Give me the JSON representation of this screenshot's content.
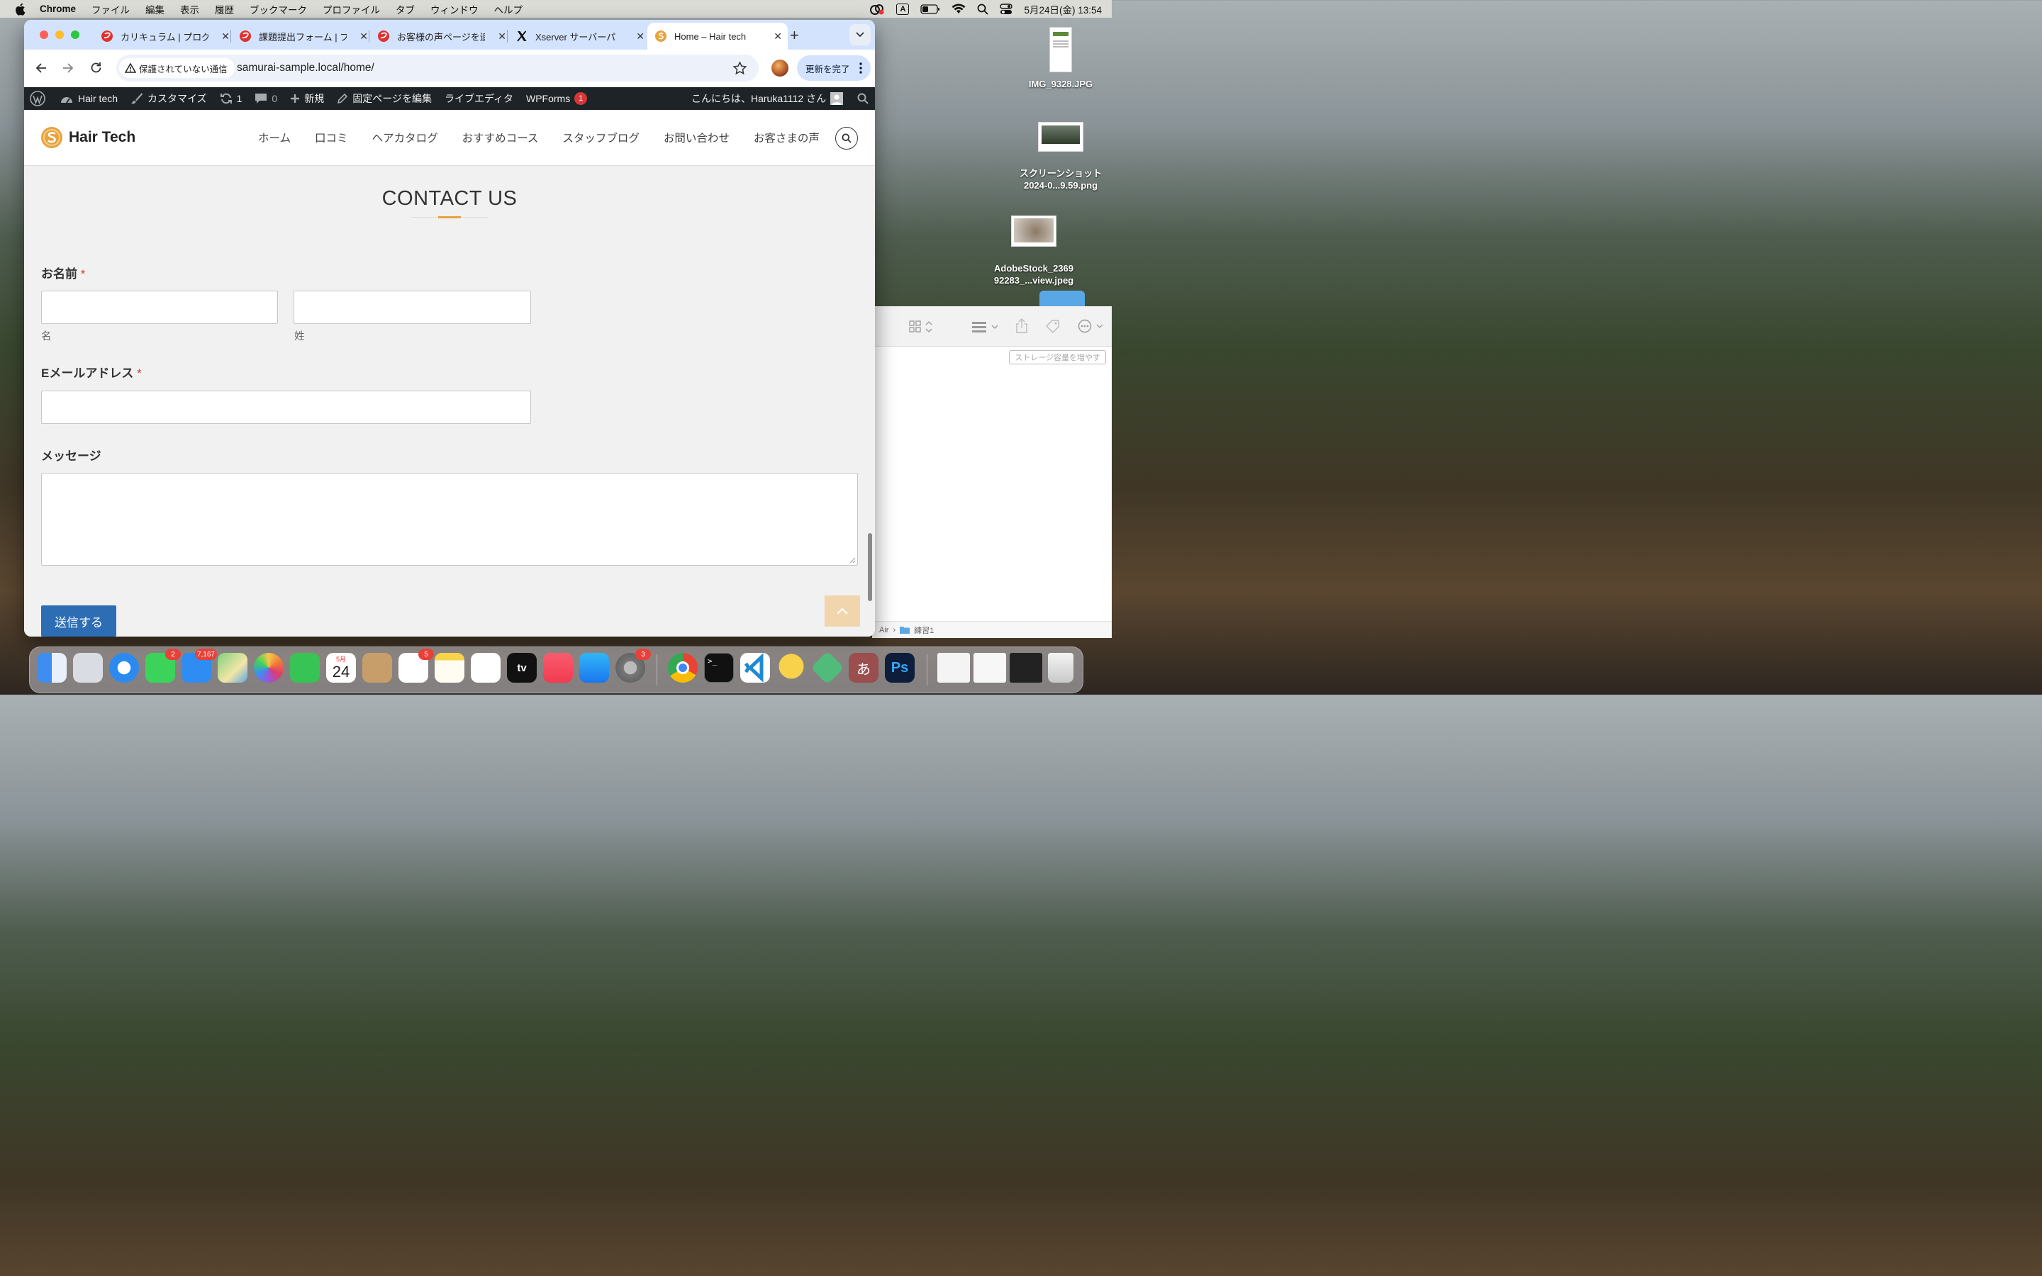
{
  "menubar": {
    "app_name": "Chrome",
    "items": [
      "ファイル",
      "編集",
      "表示",
      "履歴",
      "ブックマーク",
      "プロファイル",
      "タブ",
      "ウィンドウ",
      "ヘルプ"
    ],
    "input_indicator": "A",
    "datetime": "5月24日(金)  13:54"
  },
  "desktop": {
    "icons": [
      {
        "label": "IMG_9328.JPG"
      },
      {
        "label": "スクリーンショット\n2024-0...9.59.png"
      },
      {
        "label": "AdobeStock_2369\n92283_...view.jpeg"
      }
    ]
  },
  "finder": {
    "storage_button": "ストレージ容量を増やす",
    "path_prefix": "Air",
    "path_sep": "›",
    "path_folder": "練習1"
  },
  "browser": {
    "tabs": [
      {
        "title": "カリキュラム | プログ"
      },
      {
        "title": "課題提出フォーム | プ"
      },
      {
        "title": "お客様の声ページを追"
      },
      {
        "title": "Xserver サーバーパ"
      },
      {
        "title": "Home – Hair tech",
        "active": true
      }
    ],
    "new_tab": "+",
    "security_label": "保護されていない通信",
    "url": "samurai-sample.local/home/",
    "update_button": "更新を完了"
  },
  "wp_admin_bar": {
    "site_name": "Hair tech",
    "customize": "カスタマイズ",
    "updates_count": "1",
    "comments_count": "0",
    "new": "新規",
    "edit_page": "固定ページを編集",
    "live_editor": "ライブエディタ",
    "wpforms": "WPForms",
    "wpforms_badge": "1",
    "greeting": "こんにちは、Haruka1112 さん"
  },
  "site": {
    "logo_text": "Hair Tech",
    "nav": [
      "ホーム",
      "口コミ",
      "ヘアカタログ",
      "おすすめコース",
      "スタッフブログ",
      "お問い合わせ",
      "お客さまの声"
    ]
  },
  "form": {
    "title": "CONTACT US",
    "name_label": "お名前",
    "required_mark": "*",
    "first_name_sub": "名",
    "last_name_sub": "姓",
    "email_label": "Eメールアドレス",
    "message_label": "メッセージ",
    "submit": "送信する"
  },
  "dock": {
    "badges": {
      "messages": "2",
      "mail": "7,167",
      "reminders": "5",
      "settings": "3"
    },
    "calendar_month": "5月",
    "calendar_day": "24",
    "tv_label": "tv",
    "ime_label": "あ",
    "ps_label": "Ps"
  },
  "colors": {
    "accent_gold": "#e8a33d",
    "submit_blue": "#2d6db4",
    "required_red": "#d63638",
    "wp_bar": "#1d2327",
    "tabstrip": "#d3e3fd"
  }
}
